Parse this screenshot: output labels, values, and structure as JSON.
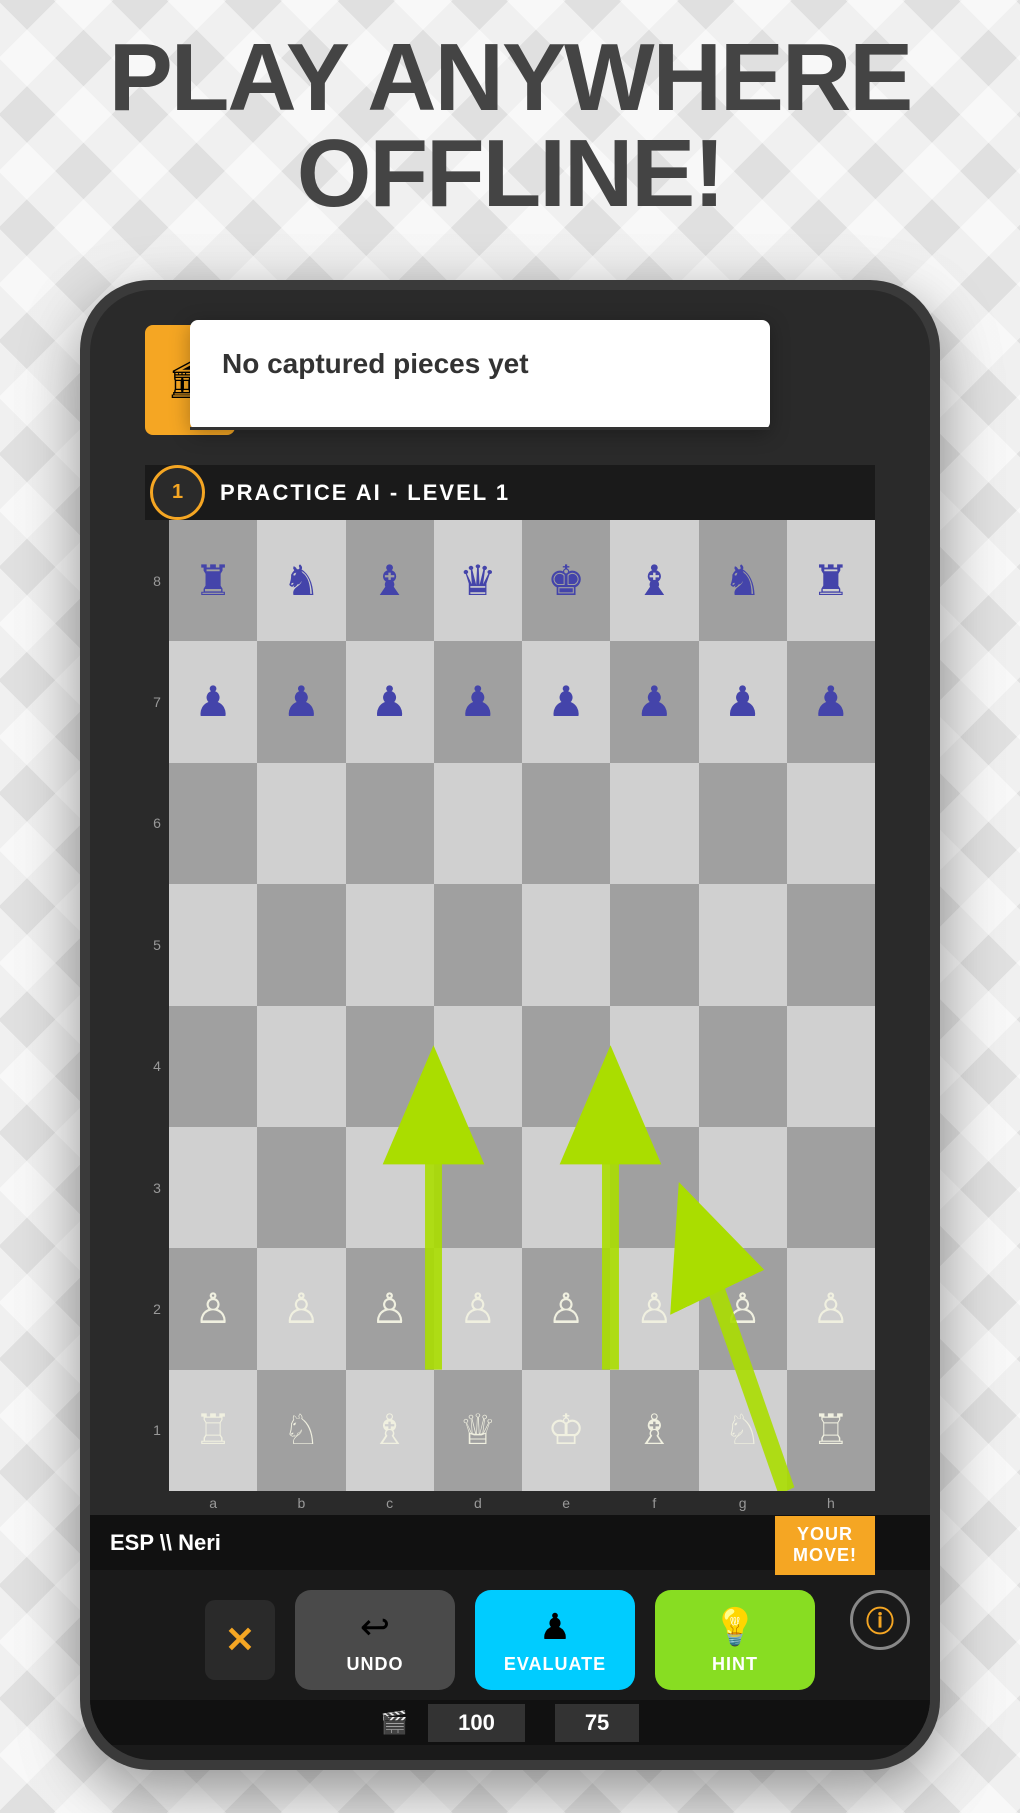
{
  "title_line1": "PLAY ANYWHERE",
  "title_line2": "OFFLINE!",
  "tooltip": {
    "text": "No captured pieces yet"
  },
  "level_bar": {
    "level_number": "1",
    "label": "PRACTICE AI - LEVEL 1"
  },
  "player": {
    "name": "ESP \\\\ Neri"
  },
  "your_move_label": "YOUR\nMOVE!",
  "buttons": {
    "close": "✕",
    "undo_label": "UNDO",
    "evaluate_label": "EVALUATE",
    "hint_label": "HINT",
    "info_label": "ⓘ"
  },
  "scores": {
    "left": "100",
    "right": "75"
  },
  "board": {
    "ranks": [
      "8",
      "7",
      "6",
      "5",
      "4",
      "3",
      "2",
      "1"
    ],
    "files": [
      "a",
      "b",
      "c",
      "d",
      "e",
      "f",
      "g",
      "h"
    ]
  },
  "icon_names": {
    "castle": "🏛",
    "undo_icon": "↩",
    "evaluate_icon": "♟",
    "hint_icon": "💡",
    "info_icon": "ℹ"
  }
}
